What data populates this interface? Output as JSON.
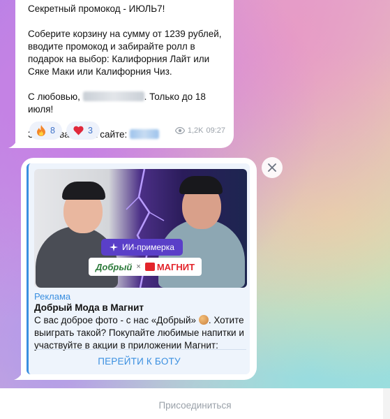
{
  "post": {
    "line1": "Секретный промокод - ИЮЛЬ7!",
    "line2": "Соберите корзину на сумму от 1239 рублей, вводите промокод и забирайте ролл в подарок на выбор: Калифорния Лайт или Сяке Маки или Калифорния Чиз.",
    "line3_before": "С любовью,",
    "line3_after": ". Только до 18 июля!",
    "line4": "Заказывайте на сайте:",
    "reactions": [
      {
        "icon": "fire-icon",
        "count": "8"
      },
      {
        "icon": "heart-icon",
        "count": "3"
      }
    ],
    "views": "1,2K",
    "time": "09:27"
  },
  "ad": {
    "image_badge": "ИИ-примерка",
    "brand_left": "Добрый",
    "brand_x": "×",
    "brand_right": "МАГНИТ",
    "label": "Реклама",
    "title": "Добрый Мода в Магнит",
    "desc_before": "С вас доброе фото - с нас «Добрый»",
    "desc_after": ". Хотите выиграть такой? Покупайте любимые напитки и участвуйте в акции в приложении Магнит:",
    "button": "ПЕРЕЙТИ К БОТУ"
  },
  "footer": {
    "join": "Присоединиться"
  },
  "colors": {
    "accent": "#3a8fe0",
    "reaction_text": "#3f72c8",
    "meta": "#9aa1a9"
  }
}
